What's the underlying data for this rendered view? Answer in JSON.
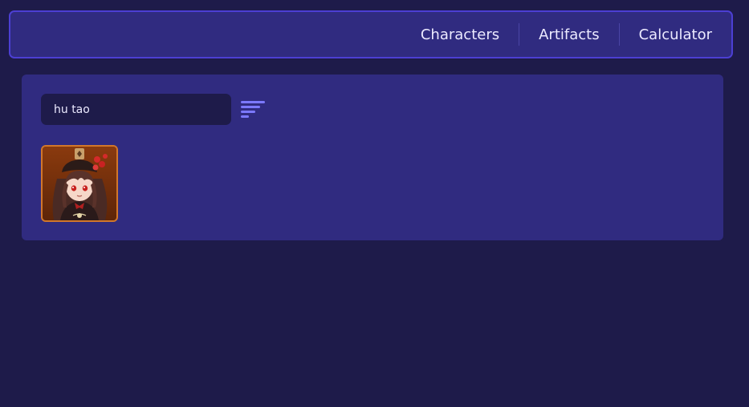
{
  "nav": {
    "items": [
      {
        "label": "Characters"
      },
      {
        "label": "Artifacts"
      },
      {
        "label": "Calculator"
      }
    ]
  },
  "search": {
    "value": "hu tao",
    "placeholder": ""
  },
  "sort": {
    "icon": "sort-lines-icon"
  },
  "results": [
    {
      "character": "Hu Tao",
      "icon": "hu-tao-portrait",
      "rarity_color": "#d2772a"
    }
  ],
  "colors": {
    "background": "#1e1b4a",
    "panel": "#302b80",
    "topbar_border": "#4c3fd3",
    "accent_icon": "#7c79ff",
    "card_border": "#d2772a"
  }
}
